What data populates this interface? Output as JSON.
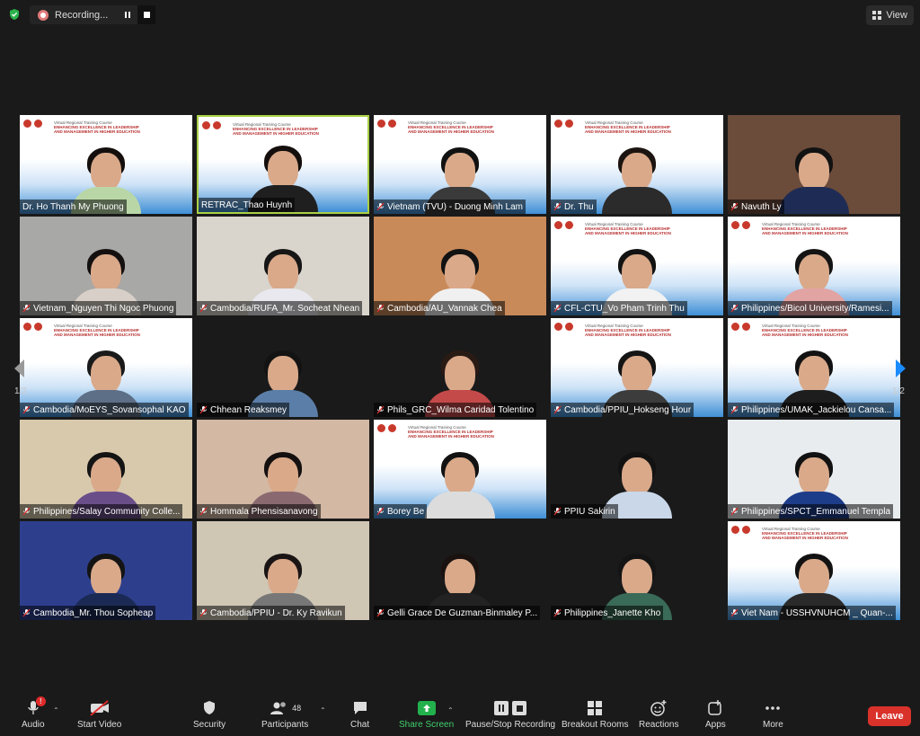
{
  "top": {
    "recording_label": "Recording...",
    "view_label": "View"
  },
  "pager": {
    "left": "1/2",
    "right": "1/2"
  },
  "participants": [
    {
      "name": "Dr. Ho Thanh My Phuong",
      "bg": "banner",
      "shirt": "#b9d7a6",
      "hair": "#140f0d",
      "active": false,
      "muted": false
    },
    {
      "name": "RETRAC_Thao Huynh",
      "bg": "banner",
      "shirt": "#1f1f1f",
      "hair": "#140f0d",
      "active": true,
      "muted": false
    },
    {
      "name": "Vietnam (TVU) - Duong Minh Lam",
      "bg": "banner",
      "shirt": "#3a3a3a",
      "hair": "#111111",
      "active": false,
      "muted": true
    },
    {
      "name": "Dr. Thu",
      "bg": "banner",
      "shirt": "#2b2b2b",
      "hair": "#1c1410",
      "active": false,
      "muted": true
    },
    {
      "name": "Navuth Ly",
      "bg": "#6b4b3a",
      "shirt": "#1e2c55",
      "hair": "#121212",
      "active": false,
      "muted": true
    },
    {
      "name": "Vietnam_Nguyen Thi Ngoc Phuong",
      "bg": "#a8a8a6",
      "shirt": "#d8d0c8",
      "hair": "#141010",
      "active": false,
      "muted": true
    },
    {
      "name": "Cambodia/RUFA_Mr. Socheat Nhean",
      "bg": "#d9d4cc",
      "shirt": "#e8e8ee",
      "hair": "#161616",
      "active": false,
      "muted": true
    },
    {
      "name": "Cambodia/AU_Vannak Chea",
      "bg": "#c98a5a",
      "shirt": "#f0f0f0",
      "hair": "#121212",
      "active": false,
      "muted": true
    },
    {
      "name": "CFL-CTU_Vo Pham Trinh Thu",
      "bg": "banner",
      "shirt": "#f2f2f2",
      "hair": "#121212",
      "active": false,
      "muted": true
    },
    {
      "name": "Philippines/Bicol University/Ramesi...",
      "bg": "banner",
      "shirt": "#e2a3a3",
      "hair": "#141414",
      "active": false,
      "muted": true
    },
    {
      "name": "Cambodia/MoEYS_Sovansophal KAO",
      "bg": "banner",
      "shirt": "#5d6f86",
      "hair": "#1a1a1a",
      "active": false,
      "muted": true
    },
    {
      "name": "Chhean Reaksmey",
      "bg": "#1a1a1a",
      "shirt": "#5b7ea8",
      "hair": "#131313",
      "active": false,
      "muted": true
    },
    {
      "name": "Phils_GRC_Wilma Caridad Tolentino",
      "bg": "#1a1a1a",
      "shirt": "#c44a4a",
      "hair": "#2a1a14",
      "active": false,
      "muted": true
    },
    {
      "name": "Cambodia/PPIU_Hokseng Hour",
      "bg": "banner",
      "shirt": "#3c3c3c",
      "hair": "#141414",
      "active": false,
      "muted": true
    },
    {
      "name": "Philippines/UMAK_Jackielou Cansa...",
      "bg": "banner",
      "shirt": "#1d1d1d",
      "hair": "#121212",
      "active": false,
      "muted": true
    },
    {
      "name": "Philippines/Salay Community Colle...",
      "bg": "#d8c9ad",
      "shirt": "#6a4e8a",
      "hair": "#141414",
      "active": false,
      "muted": true
    },
    {
      "name": "Hommala Phensisanavong",
      "bg": "#d3b8a4",
      "shirt": "#8a6a70",
      "hair": "#141010",
      "active": false,
      "muted": true
    },
    {
      "name": "Borey Be",
      "bg": "banner",
      "shirt": "#dcdcdc",
      "hair": "#121212",
      "active": false,
      "muted": true
    },
    {
      "name": "PPIU Sakirin",
      "bg": "#1a1a1a",
      "shirt": "#c9d7e8",
      "hair": "#121212",
      "active": false,
      "muted": true
    },
    {
      "name": "Philippines/SPCT_Emmanuel Templa",
      "bg": "#e8ecef",
      "shirt": "#1d3d8a",
      "hair": "#111111",
      "active": false,
      "muted": true
    },
    {
      "name": "Cambodia_Mr. Thou Sopheap",
      "bg": "#2d3f8c",
      "shirt": "#1b2a55",
      "hair": "#141414",
      "active": false,
      "muted": true
    },
    {
      "name": "Cambodia/PPIU - Dr. Ky Ravikun",
      "bg": "#cfc6b4",
      "shirt": "#777777",
      "hair": "#1a1414",
      "active": false,
      "muted": true
    },
    {
      "name": "Gelli Grace De Guzman-Binmaley P...",
      "bg": "#1a1a1a",
      "shirt": "#222222",
      "hair": "#1a1210",
      "active": false,
      "muted": true
    },
    {
      "name": "Philippines_Janette Kho",
      "bg": "#1a1a1a",
      "shirt": "#3a6a58",
      "hair": "#141414",
      "active": false,
      "muted": true
    },
    {
      "name": "Viet Nam - USSHVNUHCM _ Quan-...",
      "bg": "banner",
      "shirt": "#2a2a2a",
      "hair": "#121212",
      "active": false,
      "muted": true
    }
  ],
  "banner": {
    "small": "Virtual Regional Training Course",
    "line1": "ENHANCING EXCELLENCE IN LEADERSHIP",
    "line2": "AND MANAGEMENT IN HIGHER EDUCATION"
  },
  "toolbar": {
    "audio": "Audio",
    "audio_badge": "!",
    "start_video": "Start Video",
    "security": "Security",
    "participants": "Participants",
    "participants_count": "48",
    "chat": "Chat",
    "share_screen": "Share Screen",
    "pause_stop_recording": "Pause/Stop Recording",
    "breakout_rooms": "Breakout Rooms",
    "reactions": "Reactions",
    "apps": "Apps",
    "more": "More",
    "leave": "Leave"
  }
}
